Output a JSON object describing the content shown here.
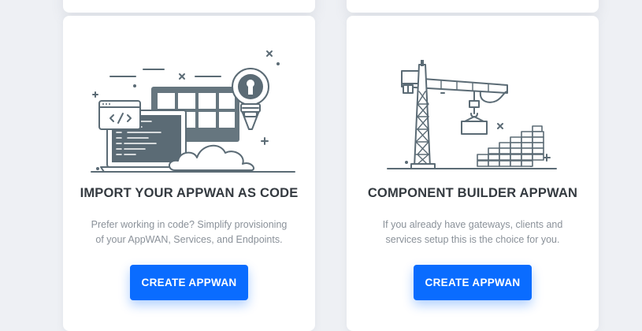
{
  "cards": [
    {
      "title": "IMPORT YOUR APPWAN AS CODE",
      "description": "Prefer working in code? Simplify provisioning of your AppWAN, Services, and Endpoints.",
      "button_label": "CREATE APPWAN",
      "illustration": "code-editor-lightbulb-illustration"
    },
    {
      "title": "COMPONENT BUILDER APPWAN",
      "description": "If you already have gateways, clients and services setup this is the choice for you.",
      "button_label": "CREATE APPWAN",
      "illustration": "construction-crane-illustration"
    }
  ],
  "colors": {
    "primary_button": "#0a6cff",
    "illustration_stroke": "#5b6b75",
    "page_background": "#eef0f4"
  }
}
